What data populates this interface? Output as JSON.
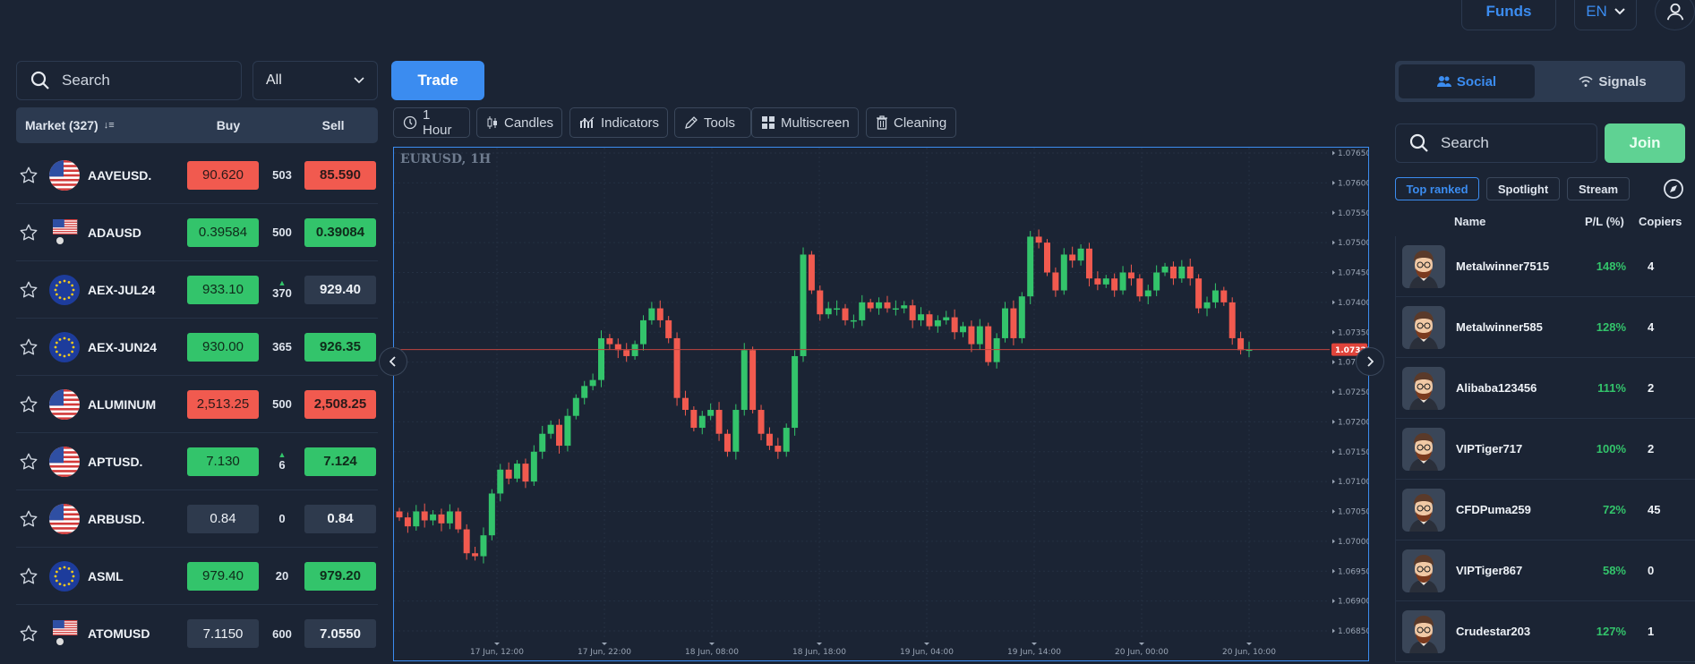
{
  "header": {
    "funds_label": "Funds",
    "language": "EN"
  },
  "market": {
    "search_placeholder": "Search",
    "filter_value": "All",
    "columns": {
      "market": "Market (327)",
      "buy": "Buy",
      "sell": "Sell"
    },
    "rows": [
      {
        "symbol": "AAVEUSD.",
        "buy": "90.620",
        "spread": "503",
        "sell": "85.590",
        "buy_color": "red",
        "sell_color": "red",
        "flag": "us",
        "arrow": false
      },
      {
        "symbol": "ADAUSD",
        "buy": "0.39584",
        "spread": "500",
        "sell": "0.39084",
        "buy_color": "green",
        "sell_color": "green",
        "flag": "us-square",
        "arrow": false
      },
      {
        "symbol": "AEX-JUL24",
        "buy": "933.10",
        "spread": "370",
        "sell": "929.40",
        "buy_color": "green",
        "sell_color": "gray",
        "flag": "eu",
        "arrow": true
      },
      {
        "symbol": "AEX-JUN24",
        "buy": "930.00",
        "spread": "365",
        "sell": "926.35",
        "buy_color": "green",
        "sell_color": "green",
        "flag": "eu",
        "arrow": false
      },
      {
        "symbol": "ALUMINUM",
        "buy": "2,513.25",
        "spread": "500",
        "sell": "2,508.25",
        "buy_color": "red",
        "sell_color": "red",
        "flag": "us",
        "arrow": false
      },
      {
        "symbol": "APTUSD.",
        "buy": "7.130",
        "spread": "6",
        "sell": "7.124",
        "buy_color": "green",
        "sell_color": "green",
        "flag": "us",
        "arrow": true
      },
      {
        "symbol": "ARBUSD.",
        "buy": "0.84",
        "spread": "0",
        "sell": "0.84",
        "buy_color": "gray",
        "sell_color": "gray",
        "flag": "us",
        "arrow": false
      },
      {
        "symbol": "ASML",
        "buy": "979.40",
        "spread": "20",
        "sell": "979.20",
        "buy_color": "green",
        "sell_color": "green",
        "flag": "eu",
        "arrow": false
      },
      {
        "symbol": "ATOMUSD",
        "buy": "7.1150",
        "spread": "600",
        "sell": "7.0550",
        "buy_color": "gray",
        "sell_color": "gray",
        "flag": "us-square",
        "arrow": false
      }
    ]
  },
  "toolbar": {
    "trade_label": "Trade",
    "tools": [
      {
        "label": "1 Hour",
        "icon": "clock-icon"
      },
      {
        "label": "Candles",
        "icon": "candles-icon"
      },
      {
        "label": "Indicators",
        "icon": "indicators-icon"
      },
      {
        "label": "Tools",
        "icon": "pencil-icon"
      },
      {
        "label": "Multiscreen",
        "icon": "grid-icon"
      },
      {
        "label": "Cleaning",
        "icon": "trash-icon"
      }
    ]
  },
  "chart": {
    "symbol_label": "EURUSD, 1H",
    "current_price": "1.07321",
    "y_ticks": [
      "1.07650",
      "1.07600",
      "1.07550",
      "1.07500",
      "1.07450",
      "1.07400",
      "1.07350",
      "1.073",
      "1.07250",
      "1.07200",
      "1.07150",
      "1.07100",
      "1.07050",
      "1.07000",
      "1.06950",
      "1.06900",
      "1.06850"
    ],
    "x_ticks": [
      "17 Jun, 12:00",
      "17 Jun, 22:00",
      "18 Jun, 08:00",
      "18 Jun, 18:00",
      "19 Jun, 04:00",
      "19 Jun, 14:00",
      "20 Jun, 00:00",
      "20 Jun, 10:00"
    ],
    "colors": {
      "up": "#33c46b",
      "down": "#f15a4f",
      "accent": "#3b8cf0"
    }
  },
  "social": {
    "tab_social": "Social",
    "tab_signals": "Signals",
    "search_placeholder": "Search",
    "join_label": "Join",
    "filters": [
      "Top ranked",
      "Spotlight",
      "Stream"
    ],
    "columns": {
      "name": "Name",
      "pl": "P/L (%)",
      "copiers": "Copiers"
    },
    "traders": [
      {
        "name": "Metalwinner7515",
        "pl": "148%",
        "copiers": "4"
      },
      {
        "name": "Metalwinner585",
        "pl": "128%",
        "copiers": "4"
      },
      {
        "name": "Alibaba123456",
        "pl": "111%",
        "copiers": "2"
      },
      {
        "name": "VIPTiger717",
        "pl": "100%",
        "copiers": "2"
      },
      {
        "name": "CFDPuma259",
        "pl": "72%",
        "copiers": "45"
      },
      {
        "name": "VIPTiger867",
        "pl": "58%",
        "copiers": "0"
      },
      {
        "name": "Crudestar203",
        "pl": "127%",
        "copiers": "1"
      }
    ]
  }
}
